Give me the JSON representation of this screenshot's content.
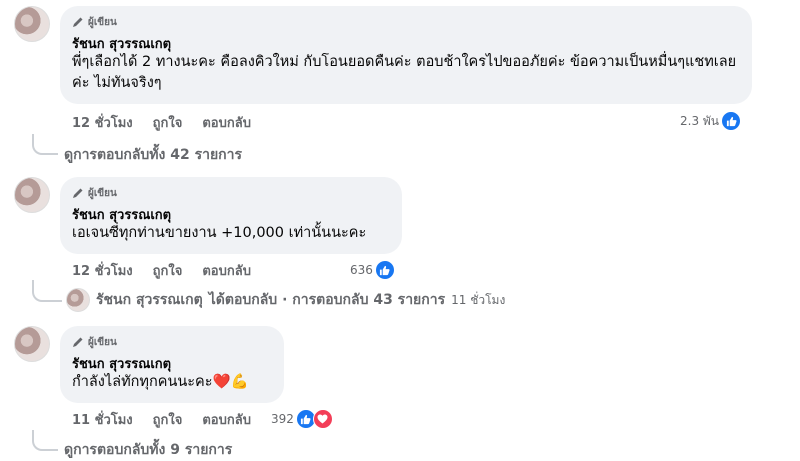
{
  "comments": [
    {
      "badge": "ผู้เขียน",
      "author": "รัชนก สุวรรณเกตุ",
      "text": "พี่ๆเลือกได้ 2 ทางนะคะ คือลงคิวใหม่ กับโอนยอดคืนค่ะ ตอบช้าใครไปขออภัยค่ะ ข้อความเป็นหมื่นๆแชทเลยค่ะ ไม่ทันจริงๆ",
      "time": "12 ชั่วโมง",
      "like": "ถูกใจ",
      "reply": "ตอบกลับ",
      "reaction_count": "2.3 พัน",
      "view_replies": "ดูการตอบกลับทั้ง 42 รายการ"
    },
    {
      "badge": "ผู้เขียน",
      "author": "รัชนก สุวรรณเกตุ",
      "text": "เอเจนซี่ทุกท่านขายงาน +10,000 เท่านั้นนะคะ",
      "time": "12 ชั่วโมง",
      "like": "ถูกใจ",
      "reply": "ตอบกลับ",
      "reaction_count": "636",
      "reply_summary": {
        "name": "รัชนก สุวรรณเกตุ",
        "action": "ได้ตอบกลับ · การตอบกลับ 43 รายการ",
        "time": "11 ชั่วโมง"
      }
    },
    {
      "badge": "ผู้เขียน",
      "author": "รัชนก สุวรรณเกตุ",
      "text": "กำลังไล่ทักทุกคนนะคะ",
      "text_emoji": "❤️💪",
      "time": "11 ชั่วโมง",
      "like": "ถูกใจ",
      "reply": "ตอบกลับ",
      "reaction_count": "392",
      "view_replies": "ดูการตอบกลับทั้ง 9 รายการ"
    }
  ],
  "colors": {
    "like_blue": "#1877f2",
    "love_red": "#f33e58",
    "bubble_bg": "#f0f2f5",
    "meta_gray": "#65676b"
  }
}
